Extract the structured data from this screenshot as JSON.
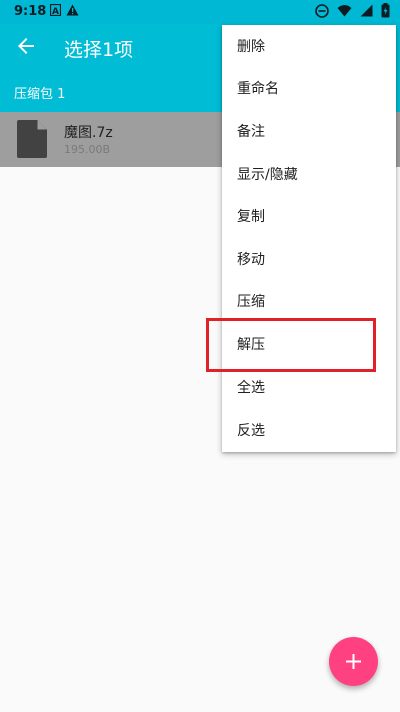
{
  "status_bar": {
    "time": "9:18",
    "icons": [
      "a-notification-icon",
      "warning-icon",
      "dnd-icon",
      "wifi-icon",
      "signal-icon",
      "battery-icon"
    ]
  },
  "app_bar": {
    "title": "选择1项",
    "back_icon": "arrow-back-icon",
    "background": "#00bcd4"
  },
  "path_bar": {
    "crumb": "压缩包 1"
  },
  "files": [
    {
      "name": "魔图.7z",
      "size": "195.00B",
      "selected": true,
      "icon": "file-icon"
    }
  ],
  "menu": {
    "items": [
      "删除",
      "重命名",
      "备注",
      "显示/隐藏",
      "复制",
      "移动",
      "压缩",
      "解压",
      "全选",
      "反选"
    ],
    "highlighted": "解压",
    "highlight_color": "#e0212a"
  },
  "fab": {
    "icon": "plus-icon",
    "color": "#ff4081"
  }
}
